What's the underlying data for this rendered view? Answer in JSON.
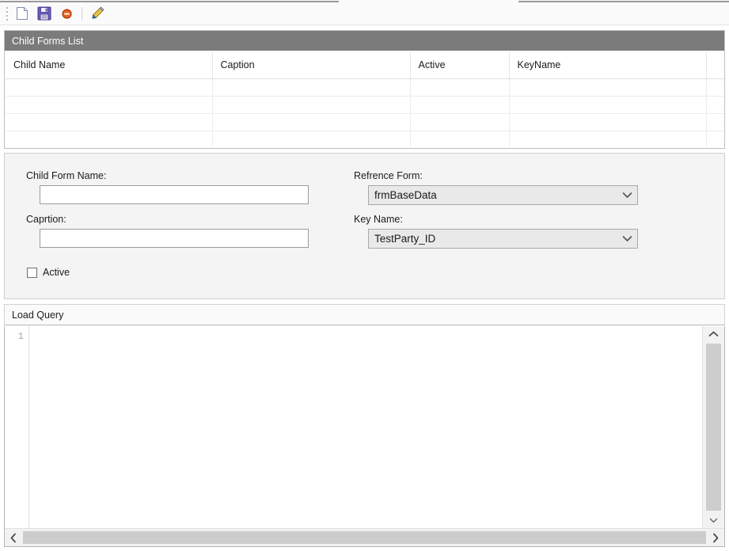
{
  "toolbar": {
    "buttons": [
      {
        "name": "new-document-button",
        "icon": "new-document-icon",
        "label": "New"
      },
      {
        "name": "save-button",
        "icon": "save-floppy-icon",
        "label": "Save"
      },
      {
        "name": "delete-button",
        "icon": "delete-circle-icon",
        "label": "Delete"
      },
      {
        "name": "edit-button",
        "icon": "pencil-edit-icon",
        "label": "Edit"
      }
    ]
  },
  "list_panel": {
    "caption": "Child Forms List",
    "columns": [
      "Child Name",
      "Caption",
      "Active",
      "KeyName"
    ],
    "rows": [
      [
        "",
        "",
        "",
        ""
      ],
      [
        "",
        "",
        "",
        ""
      ],
      [
        "",
        "",
        "",
        ""
      ],
      [
        "",
        "",
        "",
        ""
      ]
    ]
  },
  "form": {
    "child_form_name": {
      "label": "Child Form Name:",
      "value": "",
      "placeholder": ""
    },
    "caption": {
      "label": "Caprtion:",
      "value": "",
      "placeholder": ""
    },
    "reference_form": {
      "label": "Refrence Form:",
      "value": "frmBaseData",
      "options": [
        "frmBaseData"
      ]
    },
    "key_name": {
      "label": "Key Name:",
      "value": "TestParty_ID",
      "options": [
        "TestParty_ID"
      ]
    },
    "active": {
      "label": "Active",
      "checked": false
    }
  },
  "load_query": {
    "header": "Load Query",
    "line_numbers": [
      "1"
    ],
    "code": ""
  },
  "colors": {
    "caption_bar": "#7b7b7b",
    "panel_background": "#f4f4f4",
    "combo_background": "#e9e9e9",
    "scrollbar_thumb": "#cdcdcd",
    "save_icon": "#5b4fa8",
    "delete_icon": "#d9521e",
    "edit_icon": "#e8b52a"
  }
}
